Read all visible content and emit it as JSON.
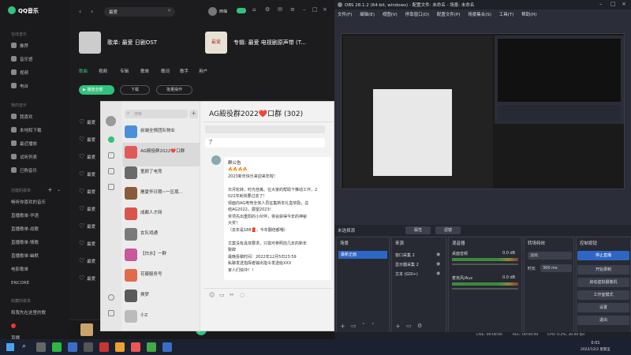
{
  "qqmusic": {
    "app_name": "QQ音乐",
    "search": "最爱",
    "user": "西柚",
    "sidebar_sections": [
      "在线音乐",
      "我的音乐",
      "创建的歌单",
      "收藏的歌单"
    ],
    "sidebar_items": [
      {
        "label": "推荐",
        "icon": "home-icon"
      },
      {
        "label": "音乐馆",
        "icon": "music-hall-icon"
      },
      {
        "label": "视频",
        "icon": "video-icon"
      },
      {
        "label": "电台",
        "icon": "radio-icon"
      },
      {
        "label": "我喜欢",
        "icon": "heart-icon"
      },
      {
        "label": "本地和下载",
        "icon": "download-icon"
      },
      {
        "label": "最近播放",
        "icon": "recent-icon"
      },
      {
        "label": "试听列表",
        "icon": "list-icon"
      },
      {
        "label": "已购音乐",
        "icon": "cart-icon"
      }
    ],
    "playlists": [
      "畅听你喜欢的音乐",
      "直播歌单-华语",
      "直播歌单-战歌",
      "直播歌单-情歌",
      "直播歌单-幽默",
      "电影歌单",
      "ENCORE",
      "和我先在这里的歌",
      "直播"
    ],
    "result_song": "歌单: 最爱 日剧OST",
    "result_album": "专辑: 最爱 电视剧原声带 (T...",
    "album_art_text": "最爱",
    "tabs": [
      "歌曲",
      "视频",
      "专辑",
      "歌单",
      "歌词",
      "歌手",
      "用户"
    ],
    "play_all": "播放全部",
    "download": "下载",
    "batch": "批量操作",
    "song_rows": [
      "最爱",
      "最爱",
      "最爱",
      "最爱",
      "最爱",
      "最爱",
      "最爱",
      "最爱",
      "最爱",
      "最爱"
    ]
  },
  "chat": {
    "search_placeholder": "搜索",
    "title": "AG殿役群2022❤️口群 (302)",
    "contacts": [
      {
        "name": "前端全情团队物业",
        "sub": "",
        "color": "#4a90d9"
      },
      {
        "name": "AG殿役群2022❤️口群",
        "sub": "",
        "color": "#e05a5a"
      },
      {
        "name": "童颜了电竞",
        "sub": "",
        "color": "#6a6a6a"
      },
      {
        "name": "屠夏怀日期~一区瓶...",
        "sub": "",
        "color": "#8a5a3a"
      },
      {
        "name": "成都人才网",
        "sub": "",
        "color": "#d9534f"
      },
      {
        "name": "女队戏通",
        "sub": "",
        "color": "#7a7a7a"
      },
      {
        "name": "【白水】一群",
        "sub": "",
        "color": "#c75a9a"
      },
      {
        "name": "花瓣服务号",
        "sub": "",
        "color": "#e06a4a"
      },
      {
        "name": "换梦",
        "sub": "",
        "color": "#5a5a5a"
      },
      {
        "name": "小Z",
        "sub": "",
        "color": "#bbbbbb"
      }
    ],
    "notice_title": "群公告",
    "notice_lines": [
      "🔥🔥🔥🔥",
      "2023新年快乐来迎来年啦！",
      "",
      "日月轮转，时光荏苒。在大家的帮助下推动工作，2",
      "022年就快要过去了！",
      "现面向AG电竞全体人员征集新年礼盒奖励，总",
      "结AG2022，展望2023！",
      "奖项先出重阳的小伙伴，将会获得今年的神秘",
      "大奖！",
      "（去年是188🧧，今年翻倍都哦）",
      "",
      "文案没有具体要求，只需可参照前几年的新年",
      "致辞",
      "最晚投稿时间：2022年12月5日23:59",
      "私聊发送指挥者输出指令发送给XXX",
      "家人们快冲！！"
    ],
    "bubble_tail": "了"
  },
  "obs": {
    "title": "OBS 28.1.2 (64-bit, windows) - 配置文件: 未命名 - 场景: 未命名",
    "menu": [
      "文件(F)",
      "编辑(E)",
      "视图(V)",
      "停靠窗口(D)",
      "配置文件(P)",
      "场景集合(S)",
      "工具(T)",
      "帮助(H)"
    ],
    "no_source": "未选择源",
    "properties_btn": "属性",
    "filters_btn": "滤镜",
    "docks": {
      "scenes": {
        "title": "场景",
        "items": [
          "最新正面"
        ]
      },
      "sources": {
        "title": "来源",
        "items": [
          "窗口采集 2",
          "显示器采集 2",
          "文本 (GDI+)"
        ]
      },
      "mixer": {
        "title": "混音器",
        "tracks": [
          {
            "name": "桌面音频",
            "level": "0.0 dB"
          },
          {
            "name": "麦克风/Aux",
            "level": "0.0 dB"
          }
        ]
      },
      "transitions": {
        "title": "转场特效",
        "type": "淡出",
        "duration_label": "时长",
        "duration": "300 ms"
      },
      "controls": {
        "title": "控制按钮",
        "buttons": [
          "停止直播",
          "开始录制",
          "启动虚拟摄像机",
          "工作室模式",
          "设置",
          "退出"
        ]
      }
    },
    "status": {
      "live": "LIVE: 00:00:00",
      "rec": "REC: 00:00:00",
      "cpu": "CPU: 0.2%, 30.00 fps"
    }
  },
  "taskbar": {
    "time": "0:01",
    "date": "2022/12/2 星期五"
  },
  "colors": {
    "qq_green": "#31c27c",
    "obs_blue": "#2e66c4",
    "chat_bg": "#f2f2f2"
  }
}
